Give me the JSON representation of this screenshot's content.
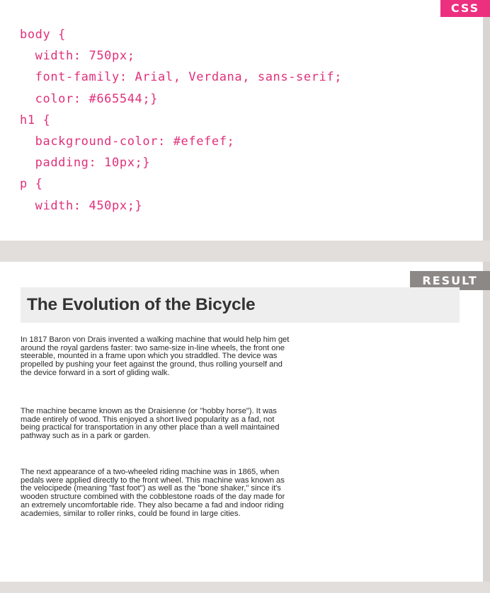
{
  "tabs": {
    "css": "CSS",
    "result": "RESULT"
  },
  "code_lines": [
    "body {",
    "  width: 750px;",
    "  font-family: Arial, Verdana, sans-serif;",
    "  color: #665544;}",
    "h1 {",
    "  background-color: #efefef;",
    "  padding: 10px;}",
    "p {",
    "  width: 450px;}"
  ],
  "result": {
    "heading": "The Evolution of the Bicycle",
    "paragraphs": [
      "In 1817 Baron von Drais invented a walking machine that would help him get around the royal gardens faster: two same-size in-line wheels, the front one steerable, mounted in a frame upon which you straddled. The device was propelled by pushing your feet against the ground, thus rolling yourself and the device forward in a sort of gliding walk.",
      "The machine became known as the Draisienne (or \"hobby horse\"). It was made entirely of wood. This enjoyed a short lived popularity as a fad, not being practical for transportation in any other place than a well maintained pathway such as in a park or garden.",
      "The next appearance of a two-wheeled riding machine was in 1865, when pedals were applied directly to the front wheel. This machine was known as the velocipede (meaning \"fast foot\") as well as the \"bone shaker,\" since it's wooden structure combined with the cobblestone roads of the day made for an extremely uncomfortable ride. They also became a fad and indoor riding academies, similar to roller rinks, could be found in large cities."
    ]
  }
}
